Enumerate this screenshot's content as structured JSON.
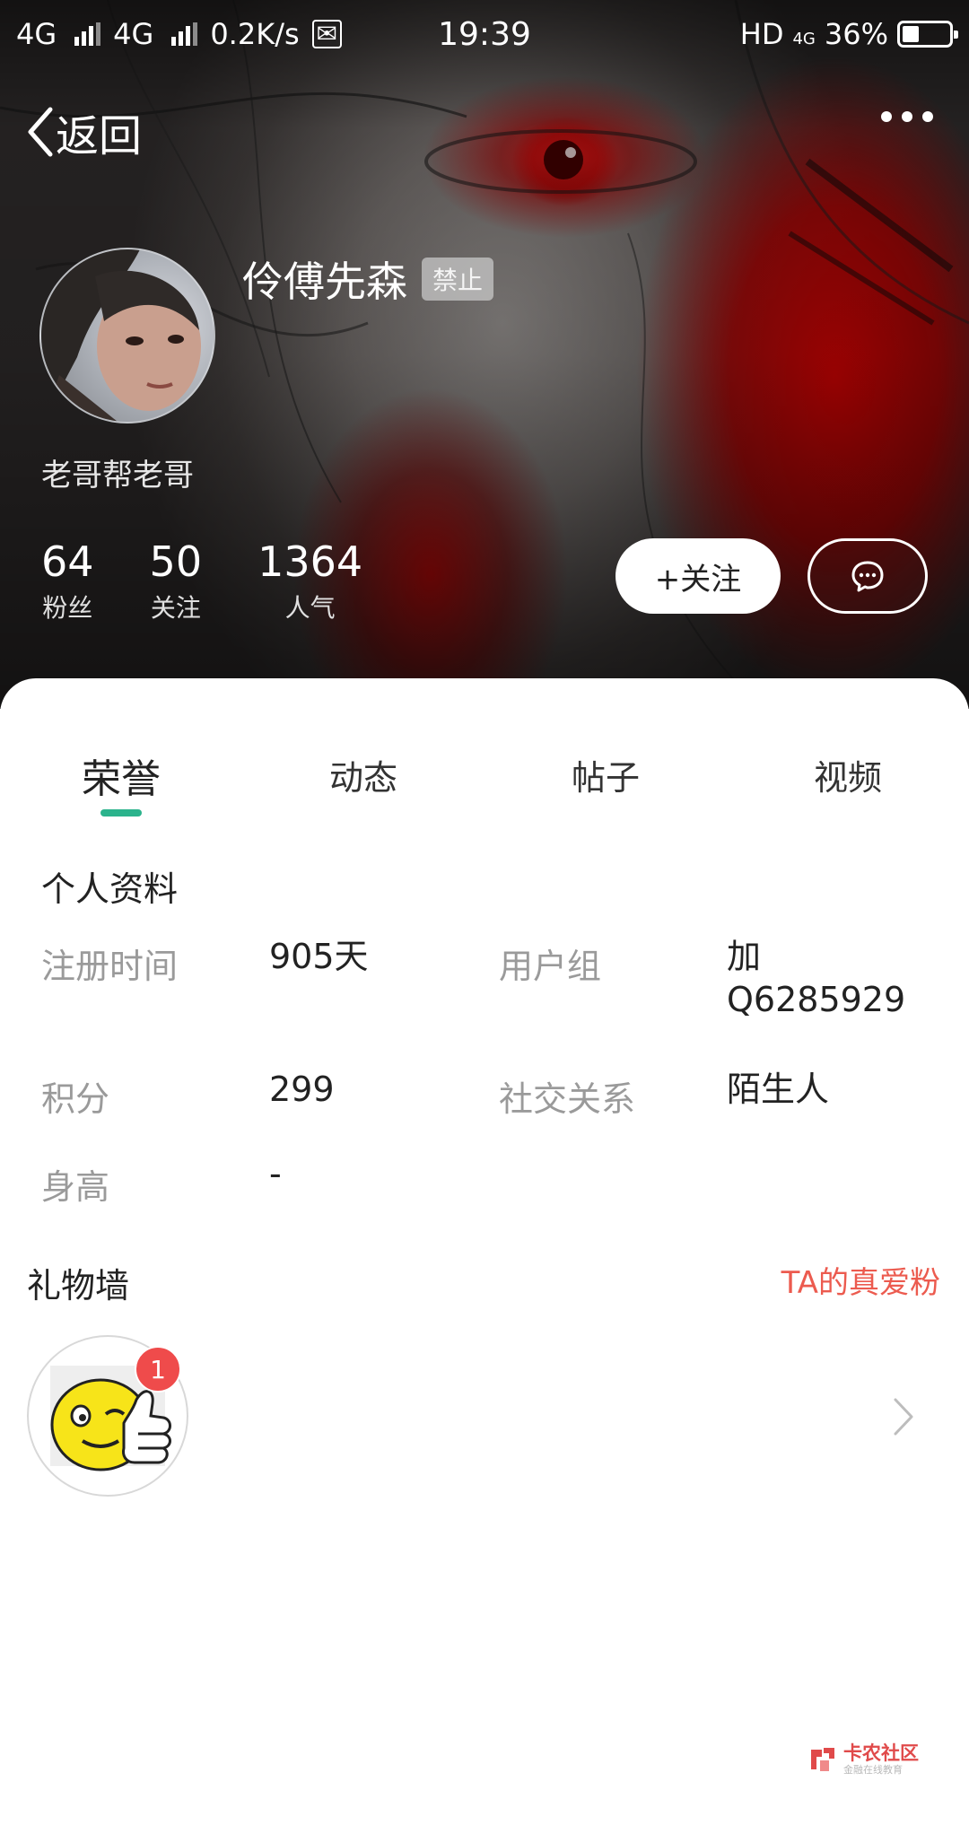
{
  "status_bar": {
    "network1": "4G",
    "network2": "4G",
    "speed": "0.2K/s",
    "time": "19:39",
    "hd": "HD",
    "net_small": "4G",
    "battery_text": "36%",
    "battery_level": 0.36
  },
  "nav": {
    "back_label": "返回"
  },
  "profile": {
    "username": "伶傅先森",
    "ban_badge": "禁止",
    "signature": "老哥帮老哥",
    "stats": [
      {
        "value": "64",
        "label": "粉丝"
      },
      {
        "value": "50",
        "label": "关注"
      },
      {
        "value": "1364",
        "label": "人气"
      }
    ],
    "follow_label": "+关注"
  },
  "tabs": [
    {
      "label": "荣誉",
      "active": true
    },
    {
      "label": "动态",
      "active": false
    },
    {
      "label": "帖子",
      "active": false
    },
    {
      "label": "视频",
      "active": false
    }
  ],
  "personal_info": {
    "title": "个人资料",
    "register_label": "注册时间",
    "register_value": "905天",
    "group_label": "用户组",
    "group_value_line1": "加",
    "group_value_line2": "Q6285929",
    "points_label": "积分",
    "points_value": "299",
    "relation_label": "社交关系",
    "relation_value": "陌生人",
    "height_label": "身高",
    "height_value": "-"
  },
  "gift_wall": {
    "title": "礼物墙",
    "fans_link": "TA的真爱粉",
    "gift_count": "1"
  },
  "watermark": {
    "title": "卡农社区",
    "subtitle": "金融在线教育"
  },
  "colors": {
    "accent_green": "#2bb38c",
    "link_red": "#ec5b4f",
    "badge_red": "#ef4b4b"
  }
}
